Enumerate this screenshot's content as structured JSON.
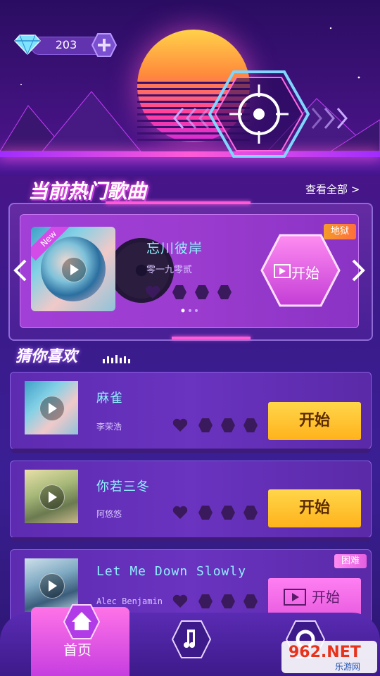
{
  "currency": {
    "value": "203"
  },
  "section_hot": {
    "title": "当前热门歌曲",
    "view_all": "查看全部 >"
  },
  "featured": {
    "title": "忘川彼岸",
    "artist": "零一九零贰",
    "new_tag": "New",
    "difficulty": "地狱",
    "start_label": "开始"
  },
  "section_like": {
    "title": "猜你喜欢"
  },
  "songs": [
    {
      "title": "麻雀",
      "artist": "李荣浩",
      "start_label": "开始",
      "style": "yellow"
    },
    {
      "title": "你若三冬",
      "artist": "阿悠悠",
      "start_label": "开始",
      "style": "yellow"
    },
    {
      "title": "Let Me Down Slowly",
      "artist": "Alec Benjamin",
      "start_label": "开始",
      "style": "pink",
      "difficulty": "困难"
    }
  ],
  "nav": {
    "home_label": "首页"
  },
  "watermark": {
    "main": "962.NET",
    "sub": "乐游网"
  },
  "colors": {
    "accent_pink": "#ff5bd7",
    "title_cyan": "#8ff0ff",
    "yellow_btn": "#ffc42a"
  }
}
